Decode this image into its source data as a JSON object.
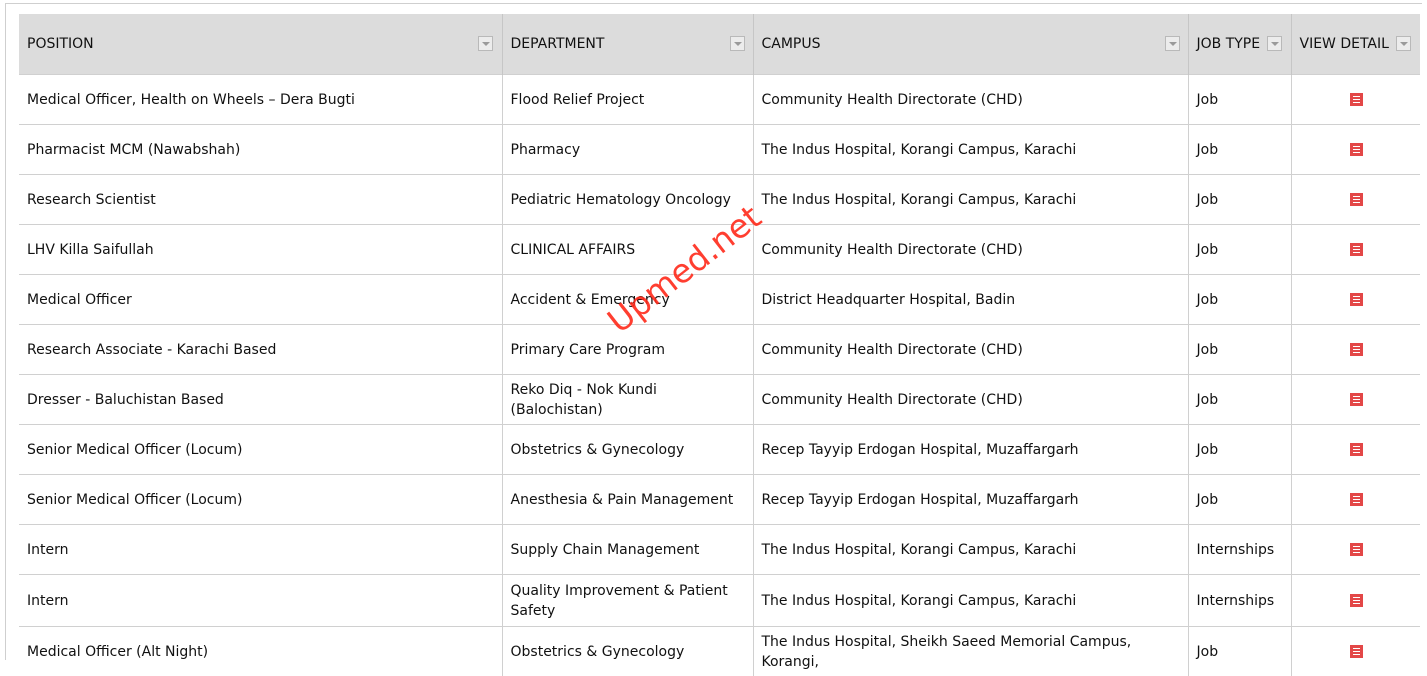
{
  "table": {
    "headers": {
      "position": "POSITION",
      "department": "DEPARTMENT",
      "campus": "CAMPUS",
      "job_type": "JOB TYPE",
      "view_detail": "VIEW DETAIL"
    },
    "rows": [
      {
        "position": "Medical Officer, Health on Wheels – Dera Bugti",
        "department": "Flood Relief Project",
        "campus": "Community Health Directorate (CHD)",
        "job_type": "Job",
        "icon": "view-detail-icon"
      },
      {
        "position": "Pharmacist MCM (Nawabshah)",
        "department": "Pharmacy",
        "campus": "The Indus Hospital, Korangi Campus, Karachi",
        "job_type": "Job",
        "icon": "view-detail-icon"
      },
      {
        "position": "Research Scientist",
        "department": "Pediatric Hematology Oncology",
        "campus": "The Indus Hospital, Korangi Campus, Karachi",
        "job_type": "Job",
        "icon": "view-detail-icon"
      },
      {
        "position": "LHV Killa Saifullah",
        "department": "CLINICAL AFFAIRS",
        "campus": "Community Health Directorate (CHD)",
        "job_type": "Job",
        "icon": "view-detail-icon"
      },
      {
        "position": "Medical Officer",
        "department": "Accident & Emergency",
        "campus": "District Headquarter Hospital, Badin",
        "job_type": "Job",
        "icon": "view-detail-icon"
      },
      {
        "position": "Research Associate - Karachi Based",
        "department": "Primary Care Program",
        "campus": "Community Health Directorate (CHD)",
        "job_type": "Job",
        "icon": "view-detail-icon"
      },
      {
        "position": "Dresser - Baluchistan Based",
        "department": "Reko Diq - Nok Kundi (Balochistan)",
        "campus": "Community Health Directorate (CHD)",
        "job_type": "Job",
        "icon": "view-detail-icon"
      },
      {
        "position": "Senior Medical Officer (Locum)",
        "department": "Obstetrics & Gynecology",
        "campus": "Recep Tayyip Erdogan Hospital, Muzaffargarh",
        "job_type": "Job",
        "icon": "view-detail-icon"
      },
      {
        "position": "Senior Medical Officer (Locum)",
        "department": "Anesthesia & Pain Management",
        "campus": "Recep Tayyip Erdogan Hospital, Muzaffargarh",
        "job_type": "Job",
        "icon": "view-detail-icon"
      },
      {
        "position": "Intern",
        "department": "Supply Chain Management",
        "campus": "The Indus Hospital, Korangi Campus, Karachi",
        "job_type": "Internships",
        "icon": "view-detail-icon"
      },
      {
        "position": "Intern",
        "department": "Quality Improvement & Patient Safety",
        "campus": "The Indus Hospital, Korangi Campus, Karachi",
        "job_type": "Internships",
        "icon": "view-detail-icon"
      },
      {
        "position": "Medical Officer (Alt Night)",
        "department": "Obstetrics & Gynecology",
        "campus": "The Indus Hospital, Sheikh Saeed Memorial Campus, Korangi,",
        "job_type": "Job",
        "icon": "view-detail-icon"
      }
    ]
  },
  "watermark": "Upmed.net",
  "colors": {
    "header_bg": "#dcdcdc",
    "icon_red": "#e34747",
    "watermark_red": "#ff2a1a"
  }
}
